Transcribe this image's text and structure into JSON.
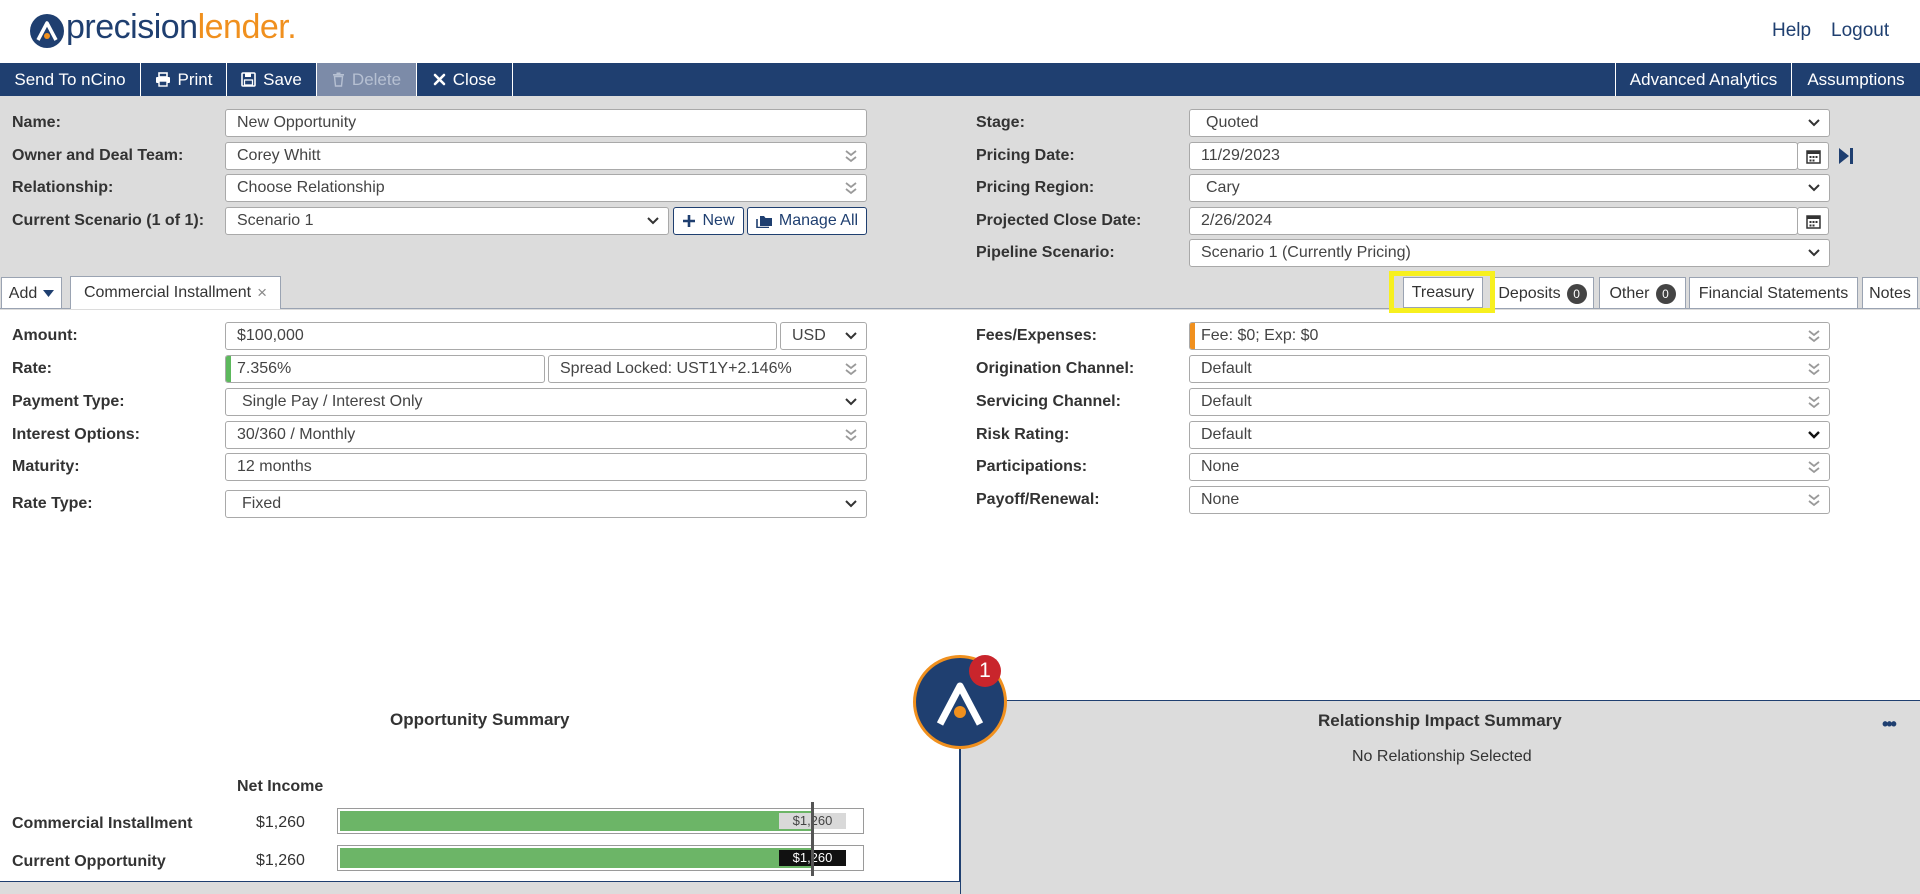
{
  "header": {
    "logo_part1": "precision",
    "logo_part2": "lender",
    "logo_dot": ".",
    "help": "Help",
    "logout": "Logout"
  },
  "toolbar": {
    "send": "Send To nCino",
    "print": "Print",
    "save": "Save",
    "delete": "Delete",
    "close": "Close",
    "analytics": "Advanced Analytics",
    "assumptions": "Assumptions"
  },
  "opportunity": {
    "name_label": "Name:",
    "name_value": "New Opportunity",
    "owner_label": "Owner and Deal Team:",
    "owner_value": "Corey Whitt",
    "relationship_label": "Relationship:",
    "relationship_value": "Choose Relationship",
    "scenario_label": "Current Scenario (1 of 1):",
    "scenario_value": "Scenario 1",
    "new_button": "New",
    "manage_button": "Manage All",
    "stage_label": "Stage:",
    "stage_value": "Quoted",
    "pricing_date_label": "Pricing Date:",
    "pricing_date_value": "11/29/2023",
    "pricing_region_label": "Pricing Region:",
    "pricing_region_value": "Cary",
    "close_date_label": "Projected Close Date:",
    "close_date_value": "2/26/2024",
    "pipeline_label": "Pipeline Scenario:",
    "pipeline_value": "Scenario 1 (Currently Pricing)"
  },
  "tabs": {
    "add": "Add",
    "commercial": "Commercial Installment",
    "close_x": "×",
    "treasury": "Treasury",
    "deposits": "Deposits",
    "deposits_count": "0",
    "other": "Other",
    "other_count": "0",
    "financial": "Financial Statements",
    "notes": "Notes"
  },
  "loan": {
    "amount_label": "Amount:",
    "amount_value": "$100,000",
    "currency": "USD",
    "rate_label": "Rate:",
    "rate_value": "7.356%",
    "spread_value": "Spread Locked: UST1Y+2.146%",
    "payment_label": "Payment Type:",
    "payment_value": "Single Pay / Interest Only",
    "interest_label": "Interest Options:",
    "interest_value": "30/360 / Monthly",
    "maturity_label": "Maturity:",
    "maturity_value": "12 months",
    "rate_type_label": "Rate Type:",
    "rate_type_value": "Fixed",
    "fees_label": "Fees/Expenses:",
    "fees_value": "Fee: $0; Exp: $0",
    "origination_label": "Origination Channel:",
    "origination_value": "Default",
    "servicing_label": "Servicing Channel:",
    "servicing_value": "Default",
    "risk_label": "Risk Rating:",
    "risk_value": "Default",
    "participations_label": "Participations:",
    "participations_value": "None",
    "payoff_label": "Payoff/Renewal:",
    "payoff_value": "None"
  },
  "summary": {
    "title": "Opportunity Summary",
    "column": "Net Income",
    "rows": [
      {
        "label": "Commercial Installment",
        "value": "$1,260",
        "bar_label": "$1,260",
        "fill_fraction": 0.9
      },
      {
        "label": "Current Opportunity",
        "value": "$1,260",
        "bar_label": "$1,260",
        "fill_fraction": 0.9
      }
    ]
  },
  "relationship_summary": {
    "title": "Relationship Impact Summary",
    "message": "No Relationship Selected",
    "more": "•••"
  },
  "assistant": {
    "notification_count": "1"
  },
  "colors": {
    "brand_navy": "#1f3f70",
    "brand_orange": "#f0901e",
    "bar_green": "#6cb567",
    "highlight_yellow": "#f7f01f",
    "panel_gray": "#dcdcdc"
  }
}
